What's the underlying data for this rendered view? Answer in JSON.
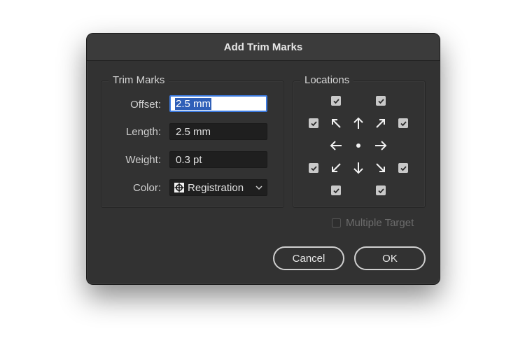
{
  "dialog": {
    "title": "Add Trim Marks"
  },
  "trim_marks": {
    "group_title": "Trim Marks",
    "offset_label": "Offset:",
    "offset_value": "2.5 mm",
    "length_label": "Length:",
    "length_value": "2.5 mm",
    "weight_label": "Weight:",
    "weight_value": "0.3 pt",
    "color_label": "Color:",
    "color_value": "Registration"
  },
  "locations": {
    "group_title": "Locations",
    "checkboxes": {
      "top_left": true,
      "top_right": true,
      "left_top": true,
      "right_top": true,
      "left_bottom": true,
      "right_bottom": true,
      "bottom_left": true,
      "bottom_right": true
    }
  },
  "multiple_target": {
    "label": "Multiple Target",
    "checked": false,
    "disabled": true
  },
  "buttons": {
    "cancel": "Cancel",
    "ok": "OK"
  },
  "icons": {
    "registration": "registration-mark-icon",
    "chevron": "chevron-down-icon",
    "arrows": [
      "arrow-up-left-icon",
      "arrow-up-icon",
      "arrow-up-right-icon",
      "arrow-left-icon",
      "center-dot-icon",
      "arrow-right-icon",
      "arrow-down-left-icon",
      "arrow-down-icon",
      "arrow-down-right-icon"
    ]
  },
  "colors": {
    "dialog_bg": "#323232",
    "focus_ring": "#3d7be0",
    "selection": "#2f5fb8"
  }
}
